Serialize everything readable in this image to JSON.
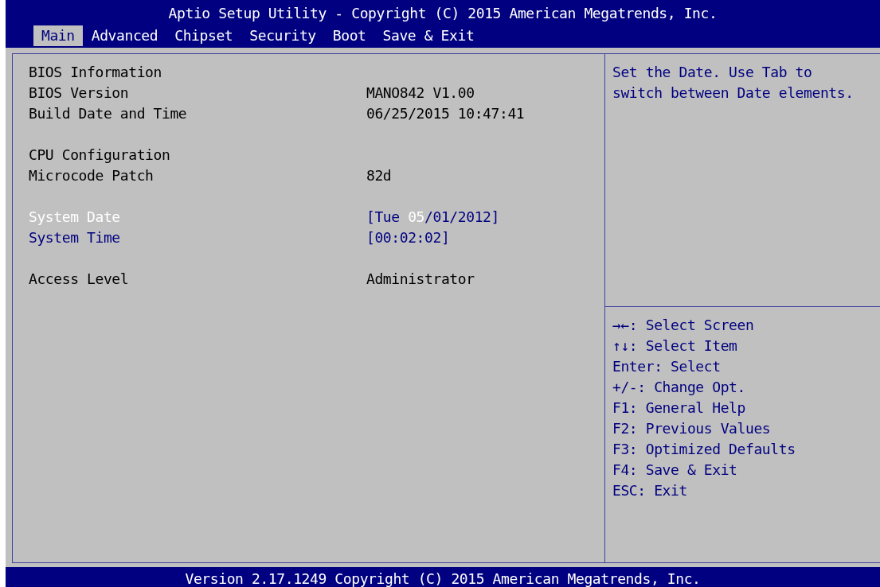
{
  "window": {
    "title": "Aptio Setup Utility - Copyright (C) 2015 American Megatrends, Inc."
  },
  "tabs": [
    {
      "label": "Main",
      "selected": true
    },
    {
      "label": "Advanced",
      "selected": false
    },
    {
      "label": "Chipset",
      "selected": false
    },
    {
      "label": "Security",
      "selected": false
    },
    {
      "label": "Boot",
      "selected": false
    },
    {
      "label": "Save & Exit",
      "selected": false
    }
  ],
  "sections": [
    {
      "rows": [
        {
          "kind": "heading",
          "label": "BIOS Information"
        },
        {
          "kind": "info",
          "label": "BIOS Version",
          "value": "MANO842 V1.00"
        },
        {
          "kind": "info",
          "label": "Build Date and Time",
          "value": "06/25/2015 10:47:41"
        }
      ]
    },
    {
      "rows": [
        {
          "kind": "heading",
          "label": "CPU Configuration"
        },
        {
          "kind": "info",
          "label": "Microcode Patch",
          "value": "82d"
        }
      ]
    },
    {
      "rows": [
        {
          "kind": "option",
          "label": "System Date",
          "selected": true,
          "value_parts": [
            {
              "text": "[Tue ",
              "selected": false
            },
            {
              "text": "05",
              "selected": true
            },
            {
              "text": "/01/2012]",
              "selected": false
            }
          ]
        },
        {
          "kind": "option",
          "label": "System Time",
          "selected": false,
          "value_parts": [
            {
              "text": "[00:02:02]",
              "selected": false
            }
          ]
        }
      ]
    },
    {
      "rows": [
        {
          "kind": "info",
          "label": "Access Level",
          "value": "Administrator"
        }
      ]
    }
  ],
  "help": {
    "lines": [
      "Set the Date. Use Tab to",
      "switch between Date elements."
    ]
  },
  "keys": [
    "→←: Select Screen",
    "↑↓: Select Item",
    "Enter: Select",
    "+/-: Change Opt.",
    "F1: General Help",
    "F2: Previous Values",
    "F3: Optimized Defaults",
    "F4: Save & Exit",
    "ESC: Exit"
  ],
  "status_bar": "Version 2.17.1249 Copyright (C) 2015 American Megatrends, Inc."
}
